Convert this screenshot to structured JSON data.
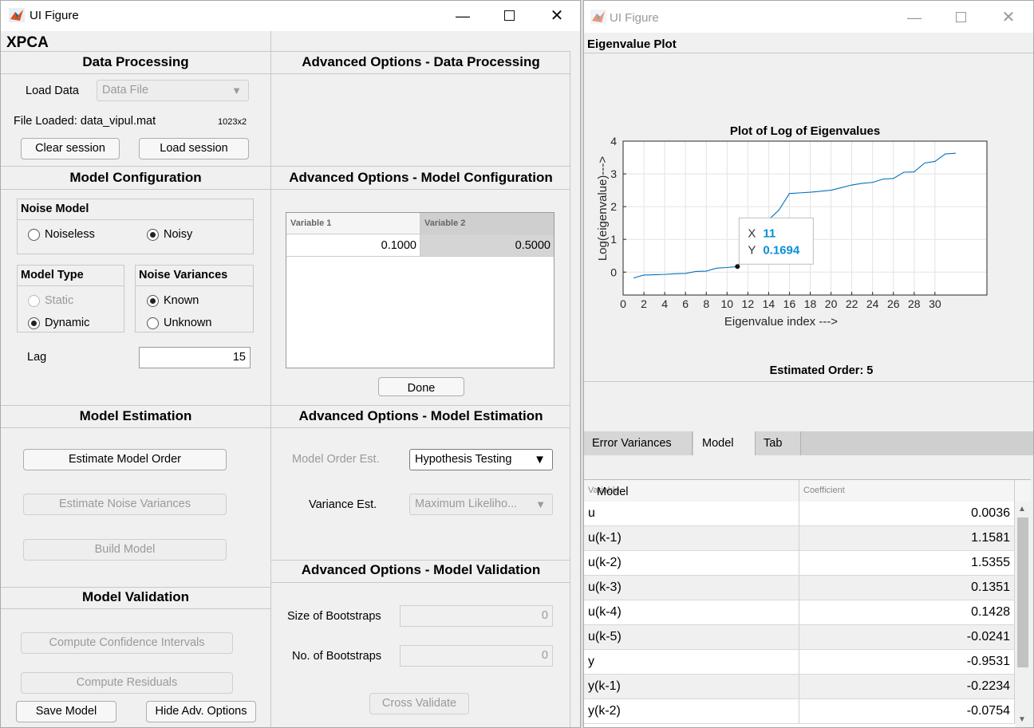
{
  "left_window": {
    "title": "UI Figure",
    "app_title": "XPCA",
    "data_processing": {
      "title": "Data Processing",
      "load_data_label": "Load Data",
      "data_file_value": "Data File",
      "file_loaded_text": "File Loaded: data_vipul.mat",
      "file_dims": "1023x2",
      "clear_session": "Clear session",
      "load_session": "Load session"
    },
    "adv_data_processing_title": "Advanced Options - Data Processing",
    "model_config": {
      "title": "Model Configuration",
      "noise_model_title": "Noise Model",
      "noiseless": "Noiseless",
      "noisy": "Noisy",
      "model_type_title": "Model Type",
      "static": "Static",
      "dynamic": "Dynamic",
      "noise_var_title": "Noise Variances",
      "known": "Known",
      "unknown": "Unknown",
      "lag_label": "Lag",
      "lag_value": "15"
    },
    "adv_model_config": {
      "title": "Advanced Options - Model Configuration",
      "col1": "Variable 1",
      "col2": "Variable 2",
      "val1": "0.1000",
      "val2": "0.5000",
      "done": "Done"
    },
    "model_estimation": {
      "title": "Model Estimation",
      "estimate_order": "Estimate Model Order",
      "estimate_noise": "Estimate Noise Variances",
      "build_model": "Build Model"
    },
    "adv_model_estimation": {
      "title": "Advanced Options - Model Estimation",
      "order_est_label": "Model Order Est.",
      "order_est_value": "Hypothesis Testing",
      "variance_est_label": "Variance  Est.",
      "variance_est_value": "Maximum Likeliho..."
    },
    "model_validation": {
      "title": "Model Validation",
      "confidence": "Compute Confidence Intervals",
      "residuals": "Compute Residuals",
      "save_model": "Save Model",
      "hide_adv": "Hide Adv. Options"
    },
    "adv_model_validation": {
      "title": "Advanced Options - Model Validation",
      "size_boot_label": "Size of Bootstraps",
      "size_boot_value": "0",
      "num_boot_label": "No. of Bootstraps",
      "num_boot_value": "0",
      "cross_validate": "Cross Validate"
    }
  },
  "right_window": {
    "title": "UI Figure",
    "section_title": "Eigenvalue Plot",
    "estimated_order": "Estimated Order: 5",
    "tabs": [
      "Error Variances",
      "Model",
      "Tab"
    ],
    "active_tab": "Model",
    "table_header_var": "Variable",
    "table_header_overlay": "Model",
    "table_header_coef": "Coefficient",
    "rows": [
      {
        "name": "u",
        "value": "0.0036"
      },
      {
        "name": "u(k-1)",
        "value": "1.1581"
      },
      {
        "name": "u(k-2)",
        "value": "1.5355"
      },
      {
        "name": "u(k-3)",
        "value": "0.1351"
      },
      {
        "name": "u(k-4)",
        "value": "0.1428"
      },
      {
        "name": "u(k-5)",
        "value": "-0.0241"
      },
      {
        "name": "y",
        "value": "-0.9531"
      },
      {
        "name": "y(k-1)",
        "value": "-0.2234"
      },
      {
        "name": "y(k-2)",
        "value": "-0.0754"
      }
    ]
  },
  "chart_data": {
    "type": "line",
    "title": "Plot of Log of Eigenvalues",
    "xlabel": "Eigenvalue index --->",
    "ylabel": "Log(eigenvalue)--->",
    "xlim": [
      0,
      35
    ],
    "ylim": [
      -0.7,
      4
    ],
    "xticks": [
      0,
      2,
      4,
      6,
      8,
      10,
      12,
      14,
      16,
      18,
      20,
      22,
      24,
      26,
      28,
      30
    ],
    "yticks": [
      0,
      1,
      2,
      3,
      4
    ],
    "grid": true,
    "color": "#0072BD",
    "x": [
      1,
      2,
      3,
      4,
      5,
      6,
      7,
      8,
      9,
      10,
      11,
      12,
      13,
      14,
      15,
      16,
      17,
      18,
      19,
      20,
      21,
      22,
      23,
      24,
      25,
      26,
      27,
      28,
      29,
      30,
      31,
      32
    ],
    "y": [
      -0.18,
      -0.09,
      -0.08,
      -0.07,
      -0.05,
      -0.04,
      0.02,
      0.03,
      0.12,
      0.14,
      0.1694,
      0.7,
      1.2,
      1.6,
      1.9,
      2.4,
      2.42,
      2.44,
      2.47,
      2.5,
      2.58,
      2.66,
      2.71,
      2.74,
      2.84,
      2.86,
      3.05,
      3.06,
      3.33,
      3.38,
      3.61,
      3.63
    ],
    "datatip": {
      "x_label": "X",
      "y_label": "Y",
      "x": "11",
      "y": "0.1694"
    }
  }
}
